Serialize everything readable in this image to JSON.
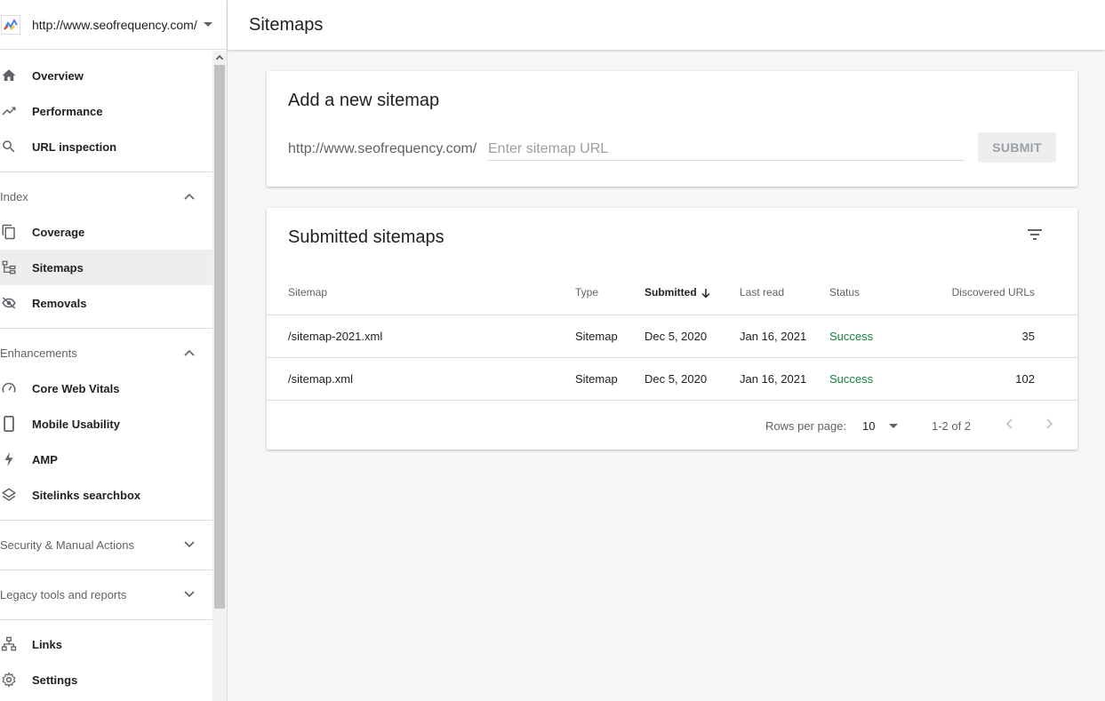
{
  "property": {
    "url": "http://www.seofrequency.com/"
  },
  "header": {
    "title": "Sitemaps"
  },
  "nav": {
    "top_items": [
      {
        "label": "Overview",
        "icon": "home-icon"
      },
      {
        "label": "Performance",
        "icon": "trending-up-icon"
      },
      {
        "label": "URL inspection",
        "icon": "search-icon"
      }
    ],
    "index": {
      "label": "Index",
      "items": [
        {
          "label": "Coverage",
          "icon": "copy-icon"
        },
        {
          "label": "Sitemaps",
          "icon": "sitemap-icon",
          "active": true
        },
        {
          "label": "Removals",
          "icon": "eye-off-icon"
        }
      ]
    },
    "enhancements": {
      "label": "Enhancements",
      "items": [
        {
          "label": "Core Web Vitals",
          "icon": "speedometer-icon"
        },
        {
          "label": "Mobile Usability",
          "icon": "phone-icon"
        },
        {
          "label": "AMP",
          "icon": "bolt-icon"
        },
        {
          "label": "Sitelinks searchbox",
          "icon": "layers-icon"
        }
      ]
    },
    "security": {
      "label": "Security & Manual Actions"
    },
    "legacy": {
      "label": "Legacy tools and reports"
    },
    "bottom_items": [
      {
        "label": "Links",
        "icon": "links-icon"
      },
      {
        "label": "Settings",
        "icon": "gear-icon"
      }
    ]
  },
  "add_sitemap": {
    "title": "Add a new sitemap",
    "prefix": "http://www.seofrequency.com/",
    "placeholder": "Enter sitemap URL",
    "value": "",
    "submit_label": "SUBMIT"
  },
  "submitted": {
    "title": "Submitted sitemaps",
    "columns": [
      "Sitemap",
      "Type",
      "Submitted",
      "Last read",
      "Status",
      "Discovered URLs"
    ],
    "rows": [
      {
        "sitemap": "/sitemap-2021.xml",
        "type": "Sitemap",
        "submitted": "Dec 5, 2020",
        "last_read": "Jan 16, 2021",
        "status": "Success",
        "discovered": "35"
      },
      {
        "sitemap": "/sitemap.xml",
        "type": "Sitemap",
        "submitted": "Dec 5, 2020",
        "last_read": "Jan 16, 2021",
        "status": "Success",
        "discovered": "102"
      }
    ],
    "pagination": {
      "rows_per_page_label": "Rows per page:",
      "rows_per_page": "10",
      "range": "1-2 of 2"
    }
  },
  "colors": {
    "success": "#188038",
    "active_nav_bg": "#eeeeee",
    "text_primary": "#202124",
    "text_secondary": "#5f6368"
  }
}
